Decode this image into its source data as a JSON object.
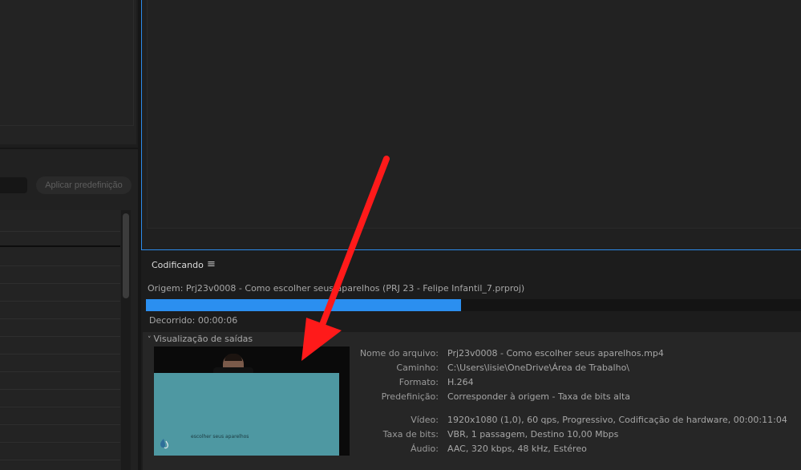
{
  "colors": {
    "accent": "#2d8ceb",
    "progress": "#2b8ff0",
    "annotation_arrow": "#ff1a1a"
  },
  "presets": {
    "apply_button_label": "Aplicar predefinição"
  },
  "encoding": {
    "tab_label": "Codificando",
    "menu_icon": "hamburger-menu-icon",
    "origin_text": "Origem: Prj23v0008 - Como escolher seus aparelhos (PRJ 23 - Felipe Infantil_7.prproj)",
    "progress_fraction": 0.481,
    "elapsed_text": "Decorrido: 00:00:06",
    "output_preview_label": "Visualização de saídas",
    "thumbnail_caption": "escolher seus aparelhos",
    "details": [
      {
        "label": "Nome do arquivo:",
        "value": "Prj23v0008 - Como escolher seus aparelhos.mp4"
      },
      {
        "label": "Caminho:",
        "value": "C:\\Users\\lisie\\OneDrive\\Área de Trabalho\\"
      },
      {
        "label": "Formato:",
        "value": "H.264"
      },
      {
        "label": "Predefinição:",
        "value": "Corresponder à origem - Taxa de bits alta"
      },
      {
        "label": "Vídeo:",
        "value": "1920x1080 (1,0), 60 qps, Progressivo, Codificação de hardware, 00:00:11:04"
      },
      {
        "label": "Taxa de bits:",
        "value": "VBR, 1 passagem, Destino 10,00 Mbps"
      },
      {
        "label": "Áudio:",
        "value": "AAC, 320 kbps, 48 kHz, Estéreo"
      }
    ]
  }
}
